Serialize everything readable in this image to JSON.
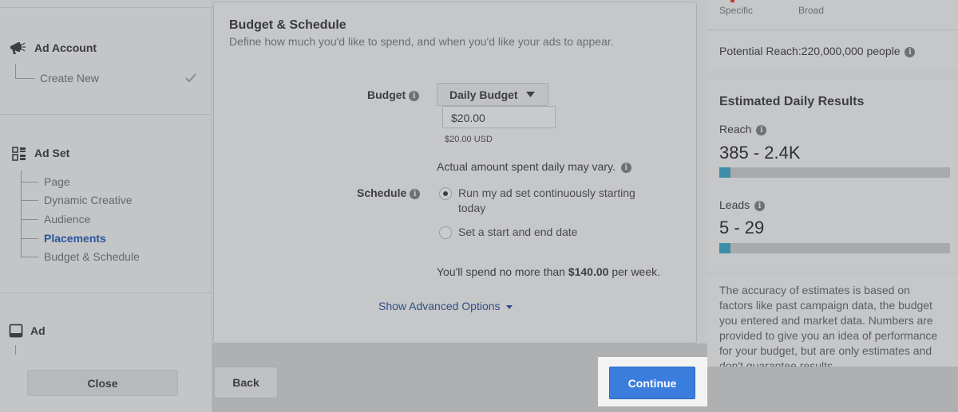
{
  "sidebar": {
    "ad_account": {
      "title": "Ad Account",
      "create_new": "Create New"
    },
    "ad_set": {
      "title": "Ad Set",
      "items": [
        {
          "label": "Page",
          "active": false
        },
        {
          "label": "Dynamic Creative",
          "active": false
        },
        {
          "label": "Audience",
          "active": false
        },
        {
          "label": "Placements",
          "active": true
        },
        {
          "label": "Budget & Schedule",
          "active": false
        }
      ]
    },
    "ad": {
      "title": "Ad"
    },
    "close_label": "Close"
  },
  "card": {
    "title": "Budget & Schedule",
    "subtitle": "Define how much you'd like to spend, and when you'd like your ads to appear.",
    "budget_label": "Budget",
    "budget_type": "Daily Budget",
    "budget_value": "$20.00",
    "budget_usd": "$20.00 USD",
    "vary_note": "Actual amount spent daily may vary.",
    "schedule_label": "Schedule",
    "option_continuous_1": "Run my ad set continuously starting",
    "option_continuous_2": "today",
    "option_dates": "Set a start and end date",
    "spend_prefix": "You'll spend no more than ",
    "spend_amount": "$140.00",
    "spend_suffix": " per week.",
    "advanced_label": "Show Advanced Options"
  },
  "footer": {
    "back_label": "Back",
    "continue_label": "Continue"
  },
  "audience_size": {
    "specific_label": "Specific",
    "broad_label": "Broad",
    "potential_reach": "Potential Reach:220,000,000 people"
  },
  "estimates": {
    "title": "Estimated Daily Results",
    "reach_label": "Reach",
    "reach_value": "385 - 2.4K",
    "reach_fill_percent": 5,
    "leads_label": "Leads",
    "leads_value": "5 - 29",
    "leads_fill_percent": 5,
    "accuracy_lines": [
      "The accuracy of estimates is based on",
      "factors like past campaign data, the budget",
      "you entered and market data. Numbers are",
      "provided to give you an idea of performance",
      "for your budget, but are only estimates and",
      "don't guarantee results."
    ]
  },
  "colors": {
    "accent": "#3b7ddd",
    "active_link": "#29569c",
    "bar_fill": "#3e8ea8"
  }
}
